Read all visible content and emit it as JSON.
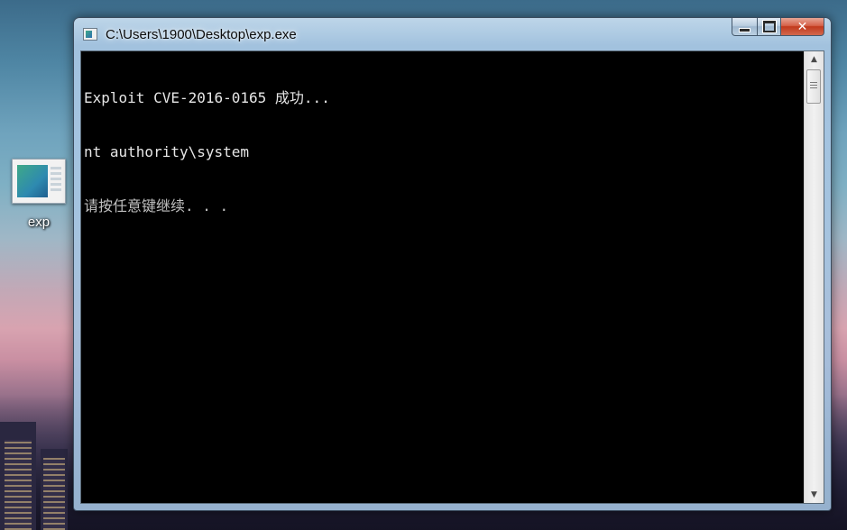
{
  "desktop": {
    "icons": [
      {
        "label": "exp",
        "icon": "console-app-icon"
      }
    ]
  },
  "window": {
    "title": "C:\\Users\\1900\\Desktop\\exp.exe",
    "icon": "console-window-icon",
    "controls": {
      "minimize": "minimize-icon",
      "maximize": "maximize-icon",
      "close": "✕"
    },
    "console": {
      "background": "#000000",
      "foreground": "#c0c0c0",
      "lines": [
        "Exploit CVE-2016-0165 成功...",
        "nt authority\\system",
        "请按任意键继续. . ."
      ]
    }
  }
}
